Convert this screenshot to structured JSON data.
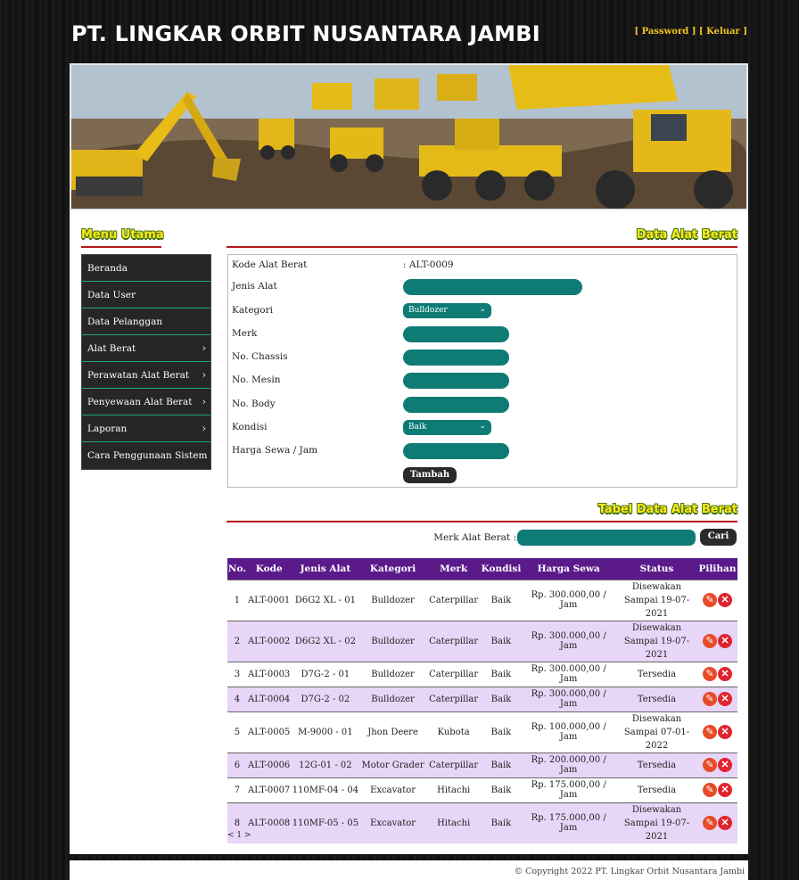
{
  "header": {
    "title": "PT. LINGKAR ORBIT NUSANTARA JAMBI",
    "password_link": "[ Password ]",
    "logout_link": "[ Keluar ]"
  },
  "sidebar": {
    "title": "Menu Utama",
    "items": [
      {
        "label": "Beranda",
        "arrow": ""
      },
      {
        "label": "Data User",
        "arrow": ""
      },
      {
        "label": "Data Pelanggan",
        "arrow": ""
      },
      {
        "label": "Alat Berat",
        "arrow": "›"
      },
      {
        "label": "Perawatan Alat Berat",
        "arrow": "›"
      },
      {
        "label": "Penyewaan Alat Berat",
        "arrow": "›"
      },
      {
        "label": "Laporan",
        "arrow": "›"
      },
      {
        "label": "Cara Penggunaan Sistem",
        "arrow": ""
      }
    ]
  },
  "form": {
    "title": "Data Alat Berat",
    "kode_label": "Kode Alat Berat",
    "kode_value": ": ALT-0009",
    "jenis_label": "Jenis Alat",
    "kategori_label": "Kategori",
    "kategori_value": "Bulldozer",
    "merk_label": "Merk",
    "chassis_label": "No. Chassis",
    "mesin_label": "No. Mesin",
    "body_label": "No. Body",
    "kondisi_label": "Kondisi",
    "kondisi_value": "Baik",
    "harga_label": "Harga Sewa / Jam",
    "submit_label": "Tambah"
  },
  "table_section": {
    "title": "Tabel Data Alat Berat",
    "search_label": "Merk Alat Berat :",
    "search_button": "Cari",
    "columns": [
      "No.",
      "Kode",
      "Jenis Alat",
      "Kategori",
      "Merk",
      "Kondisi",
      "Harga Sewa",
      "Status",
      "Pilihan"
    ],
    "rows": [
      {
        "no": "1",
        "kode": "ALT-0001",
        "jenis": "D6G2 XL - 01",
        "kategori": "Bulldozer",
        "merk": "Caterpillar",
        "kondisi": "Baik",
        "harga": "Rp. 300.000,00 / Jam",
        "status1": "Disewakan",
        "status2": "Sampai 19-07-2021"
      },
      {
        "no": "2",
        "kode": "ALT-0002",
        "jenis": "D6G2 XL - 02",
        "kategori": "Bulldozer",
        "merk": "Caterpillar",
        "kondisi": "Baik",
        "harga": "Rp. 300.000,00 / Jam",
        "status1": "Disewakan",
        "status2": "Sampai 19-07-2021"
      },
      {
        "no": "3",
        "kode": "ALT-0003",
        "jenis": "D7G-2 - 01",
        "kategori": "Bulldozer",
        "merk": "Caterpillar",
        "kondisi": "Baik",
        "harga": "Rp. 300.000,00 / Jam",
        "status1": "Tersedia",
        "status2": ""
      },
      {
        "no": "4",
        "kode": "ALT-0004",
        "jenis": "D7G-2 - 02",
        "kategori": "Bulldozer",
        "merk": "Caterpillar",
        "kondisi": "Baik",
        "harga": "Rp. 300.000,00 / Jam",
        "status1": "Tersedia",
        "status2": ""
      },
      {
        "no": "5",
        "kode": "ALT-0005",
        "jenis": "M-9000 - 01",
        "kategori": "Jhon Deere",
        "merk": "Kubota",
        "kondisi": "Baik",
        "harga": "Rp. 100.000,00 / Jam",
        "status1": "Disewakan",
        "status2": "Sampai 07-01-2022"
      },
      {
        "no": "6",
        "kode": "ALT-0006",
        "jenis": "12G-01 - 02",
        "kategori": "Motor Grader",
        "merk": "Caterpillar",
        "kondisi": "Baik",
        "harga": "Rp. 200.000,00 / Jam",
        "status1": "Tersedia",
        "status2": ""
      },
      {
        "no": "7",
        "kode": "ALT-0007",
        "jenis": "110MF-04 - 04",
        "kategori": "Excavator",
        "merk": "Hitachi",
        "kondisi": "Baik",
        "harga": "Rp. 175.000,00 / Jam",
        "status1": "Tersedia",
        "status2": ""
      },
      {
        "no": "8",
        "kode": "ALT-0008",
        "jenis": "110MF-05 - 05",
        "kategori": "Excavator",
        "merk": "Hitachi",
        "kondisi": "Baik",
        "harga": "Rp. 175.000,00 / Jam",
        "status1": "Disewakan",
        "status2": "Sampai 19-07-2021"
      }
    ],
    "edit_icon": "pencil-icon",
    "delete_icon": "x-circle-icon",
    "pager": "< 1 >"
  },
  "footer": {
    "copyright": "© Copyright 2022 PT. Lingkar Orbit Nusantara Jambi"
  },
  "colors": {
    "accent_teal": "#0e7b75",
    "table_header": "#5a1a8a",
    "row_alt": "#e8d6f8",
    "title_yellow": "#ffe81a"
  }
}
